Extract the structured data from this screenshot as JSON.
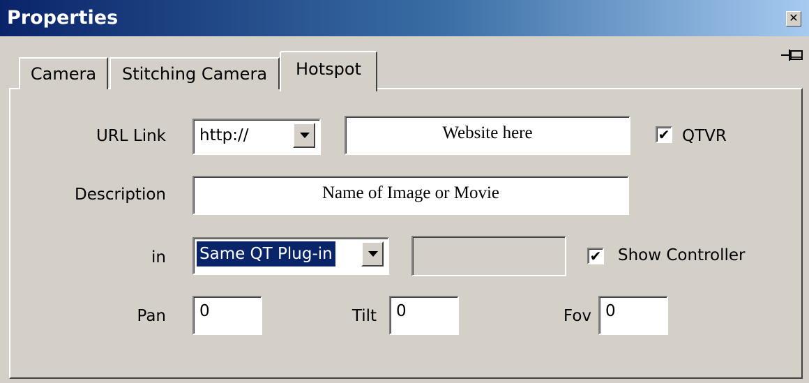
{
  "window": {
    "title": "Properties",
    "close_glyph": "✕"
  },
  "tabs": [
    {
      "label": "Camera",
      "selected": false
    },
    {
      "label": "Stitching Camera",
      "selected": false
    },
    {
      "label": "Hotspot",
      "selected": true
    }
  ],
  "url_link": {
    "label": "URL Link",
    "protocol": "http://",
    "value": "Website here",
    "qtvr_label": "QTVR",
    "qtvr_checked": true
  },
  "description": {
    "label": "Description",
    "value": "Name of Image or Movie"
  },
  "in": {
    "label": "in",
    "target": "Same QT Plug-in",
    "extra_value": "",
    "show_controller_label": "Show Controller",
    "show_controller_checked": true
  },
  "view": {
    "pan_label": "Pan",
    "pan_value": "0",
    "tilt_label": "Tilt",
    "tilt_value": "0",
    "fov_label": "Fov",
    "fov_value": "0"
  },
  "check_glyph": "✔",
  "colors": {
    "title_start": "#0a246a",
    "title_end": "#a6caf0",
    "face": "#d4d0c8",
    "selection": "#0a246a"
  }
}
